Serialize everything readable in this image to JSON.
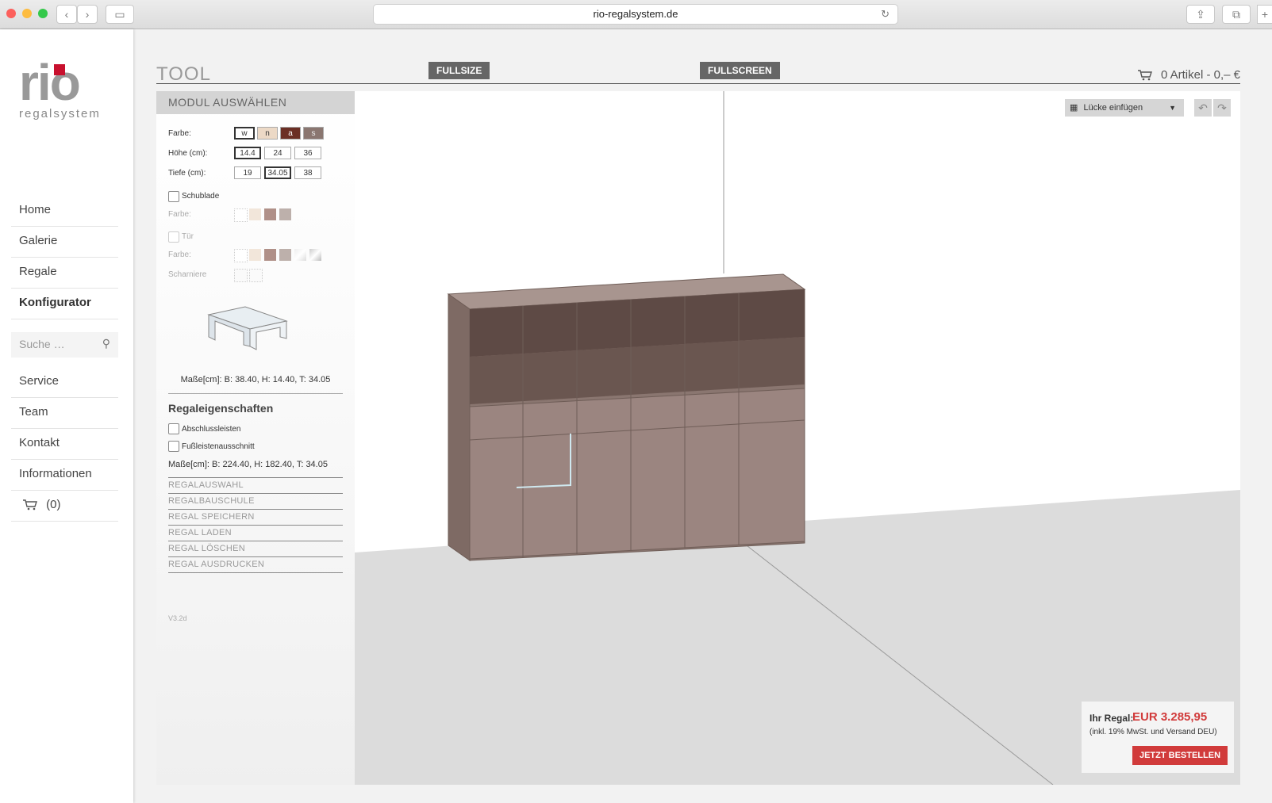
{
  "browser": {
    "url": "rio-regalsystem.de"
  },
  "logo": {
    "word": "rio",
    "sub": "regalsystem"
  },
  "nav": {
    "primary": [
      "Home",
      "Galerie",
      "Regale",
      "Konfigurator"
    ],
    "search_placeholder": "Suche …",
    "secondary": [
      "Service",
      "Team",
      "Kontakt",
      "Informationen"
    ],
    "cart": "(0)"
  },
  "header": {
    "title": "TOOL",
    "fullsize": "FULLSIZE",
    "fullscreen": "FULLSCREEN",
    "cart": "0 Artikel - 0,– €"
  },
  "panel": {
    "title": "MODUL AUSWÄHLEN",
    "farbe_label": "Farbe:",
    "farbe_opts": [
      "w",
      "n",
      "a",
      "s"
    ],
    "hoehe_label": "Höhe (cm):",
    "hoehe_opts": [
      "14.4",
      "24",
      "36"
    ],
    "tiefe_label": "Tiefe (cm):",
    "tiefe_opts": [
      "19",
      "34.05",
      "38"
    ],
    "schublade": "Schublade",
    "farbe2": "Farbe:",
    "tuer": "Tür",
    "farbe3": "Farbe:",
    "scharniere": "Scharniere",
    "module_dims": "Maße[cm]: B: 38.40, H: 14.40, T: 34.05",
    "props_title": "Regaleigenschaften",
    "abschluss": "Abschlussleisten",
    "fussleiste": "Fußleistenausschnitt",
    "shelf_dims": "Maße[cm]: B: 224.40, H: 182.40, T: 34.05",
    "links": [
      "REGALAUSWAHL",
      "REGALBAUSCHULE",
      "REGAL SPEICHERN",
      "REGAL LADEN",
      "REGAL LÖSCHEN",
      "REGAL AUSDRUCKEN"
    ],
    "version": "V3.2d"
  },
  "viewport": {
    "tool_select": "Lücke einfügen",
    "price_label": "Ihr Regal:",
    "price": "EUR 3.285,95",
    "price_note": "(inkl. 19% MwSt. und Versand DEU)",
    "order": "JETZT BESTELLEN"
  },
  "colors": {
    "accent_red": "#d13b3b",
    "shelf": "#8a7670",
    "shelf_top": "#a8958f"
  }
}
